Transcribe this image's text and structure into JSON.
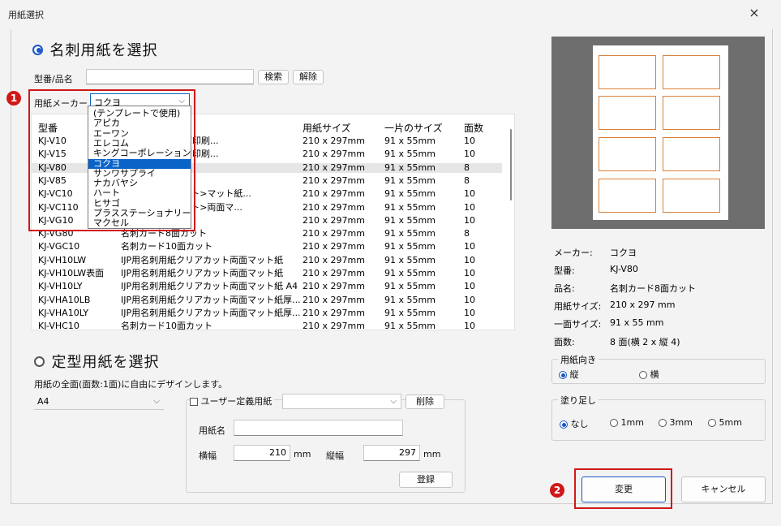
{
  "window": {
    "title": "用紙選択",
    "close_glyph": "×"
  },
  "business_card": {
    "radio_label": "名刺用紙を選択",
    "search_label": "型番/品名",
    "search_value": "",
    "search_button": "検索",
    "clear_button": "解除",
    "maker_label": "用紙メーカー",
    "maker_value": "コクヨ",
    "maker_options": [
      "(テンプレートで使用)",
      "アピカ",
      "エーワン",
      "エレコム",
      "キングコーポレーション",
      "コクヨ",
      "サンワサプライ",
      "ナカバヤシ",
      "ハート",
      "ヒサゴ",
      "プラスステーショナリー",
      "マクセル"
    ],
    "columns": [
      "型番",
      "",
      "用紙サイズ",
      "一片のサイズ",
      "面数"
    ],
    "rows": [
      [
        "KJ-V10",
        "用名刺カード両面印刷...",
        "210 x 297mm",
        "91 x 55mm",
        "10"
      ],
      [
        "KJ-V15",
        "用名刺カード両面印刷...",
        "210 x 297mm",
        "91 x 55mm",
        "10"
      ],
      [
        "KJ-V80",
        "",
        "210 x 297mm",
        "91 x 55mm",
        "8"
      ],
      [
        "KJ-V85",
        "",
        "210 x 297mm",
        "91 x 55mm",
        "8"
      ],
      [
        "KJ-VC10",
        "ード<クリアカット>マット紙...",
        "210 x 297mm",
        "91 x 55mm",
        "10"
      ],
      [
        "KJ-VC110",
        "ード<クリアカット>両面マ...",
        "210 x 297mm",
        "91 x 55mm",
        "10"
      ],
      [
        "KJ-VG10",
        "ット",
        "210 x 297mm",
        "91 x 55mm",
        "10"
      ],
      [
        "KJ-VG80",
        "名刺カード8面カット",
        "210 x 297mm",
        "91 x 55mm",
        "8"
      ],
      [
        "KJ-VGC10",
        "名刺カード10面カット",
        "210 x 297mm",
        "91 x 55mm",
        "10"
      ],
      [
        "KJ-VH10LW",
        "IJP用名刺用紙クリアカット両面マット紙",
        "210 x 297mm",
        "91 x 55mm",
        "10"
      ],
      [
        "KJ-VH10LW表面",
        "IJP用名刺用紙クリアカット両面マット紙",
        "210 x 297mm",
        "91 x 55mm",
        "10"
      ],
      [
        "KJ-VH10LY",
        "IJP用名刺用紙クリアカット両面マット紙 A4 ...",
        "210 x 297mm",
        "91 x 55mm",
        "10"
      ],
      [
        "KJ-VHA10LB",
        "IJP用名刺用紙クリアカット両面マット紙厚...",
        "210 x 297mm",
        "91 x 55mm",
        "10"
      ],
      [
        "KJ-VHA10LY",
        "IJP用名刺用紙クリアカット両面マット紙厚...",
        "210 x 297mm",
        "91 x 55mm",
        "10"
      ],
      [
        "KJ-VHC10",
        "名刺カード10面カット",
        "210 x 297mm",
        "91 x 55mm",
        "10"
      ]
    ]
  },
  "standard_paper": {
    "radio_label": "定型用紙を選択",
    "desc": "用紙の全面(面数:1面)に自由にデザインします。",
    "size_value": "A4",
    "user_defined_label": "ユーザー定義用紙",
    "user_defined_value": "",
    "delete_button": "削除",
    "paper_name_label": "用紙名",
    "paper_name_value": "",
    "width_label": "横幅",
    "width_value": "210",
    "height_label": "縦幅",
    "height_value": "297",
    "unit": "mm",
    "register_button": "登録"
  },
  "info": {
    "maker_k": "メーカー:",
    "maker_v": "コクヨ",
    "model_k": "型番:",
    "model_v": "KJ-V80",
    "name_k": "品名:",
    "name_v": "名刺カード8面カット",
    "paper_k": "用紙サイズ:",
    "paper_v": "210 x 297 mm",
    "piece_k": "一面サイズ:",
    "piece_v": "91 x 55 mm",
    "count_k": "面数:",
    "count_v": "8 面(横 2 x 縦 4)"
  },
  "orientation": {
    "title": "用紙向き",
    "portrait": "縦",
    "landscape": "横"
  },
  "bleed": {
    "title": "塗り足し",
    "none": "なし",
    "o1": "1mm",
    "o3": "3mm",
    "o5": "5mm"
  },
  "buttons": {
    "ok": "変更",
    "cancel": "キャンセル"
  },
  "badges": {
    "b1": "1",
    "b2": "2"
  },
  "colors": {
    "accent": "#1a56c6",
    "highlight": "#d01818",
    "card_border": "#d9803a"
  }
}
